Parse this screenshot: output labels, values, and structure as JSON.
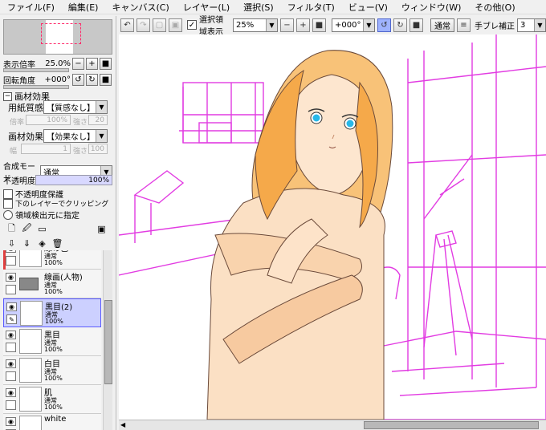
{
  "menu": [
    "ファイル(F)",
    "編集(E)",
    "キャンバス(C)",
    "レイヤー(L)",
    "選択(S)",
    "フィルタ(T)",
    "ビュー(V)",
    "ウィンドウ(W)",
    "その他(O)"
  ],
  "toolbar": {
    "selection_show": "選択領域表示",
    "zoom_value": "25%",
    "rotation_value": "+000°",
    "mode_value": "通常",
    "stabilizer_label": "手ブレ補正",
    "stabilizer_value": "3"
  },
  "nav": {
    "zoom_label": "表示倍率",
    "zoom_value": "25.0%",
    "angle_label": "回転角度",
    "angle_value": "+000°"
  },
  "texture": {
    "section": "画材効果",
    "paper_label": "用紙質感",
    "paper_value": "【質感なし】",
    "paper_strength_label": "強さ",
    "paper_strength": "20",
    "paper_scale_label": "倍率",
    "paper_scale": "100%",
    "effect_label": "画材効果",
    "effect_value": "【効果なし】",
    "effect_width_label": "幅",
    "effect_width": "1",
    "effect_strength_label": "強さ",
    "effect_strength": "100"
  },
  "blend": {
    "mode_label": "合成モード",
    "mode_value": "通常",
    "opacity_label": "不透明度",
    "opacity_value": "100%",
    "opt1": "不透明度保護",
    "opt2": "下のレイヤーでクリッピング",
    "opt3": "領域検出元に指定"
  },
  "layers": [
    {
      "name": "線の色",
      "mode": "通常",
      "opacity": "100%",
      "selected": false
    },
    {
      "name": "線画(人物)",
      "mode": "通常",
      "opacity": "100%",
      "selected": false,
      "folder": true
    },
    {
      "name": "黒目(2)",
      "mode": "通常",
      "opacity": "100%",
      "selected": true
    },
    {
      "name": "黒目",
      "mode": "通常",
      "opacity": "100%",
      "selected": false
    },
    {
      "name": "白目",
      "mode": "通常",
      "opacity": "100%",
      "selected": false
    },
    {
      "name": "肌",
      "mode": "通常",
      "opacity": "100%",
      "selected": false
    },
    {
      "name": "white",
      "mode": "",
      "opacity": "",
      "selected": false
    }
  ],
  "colors": {
    "room_lines": "#e23ce2",
    "skin": "#f7c98b",
    "hair": "#f5b04a",
    "eyes": "#28b8e8"
  }
}
